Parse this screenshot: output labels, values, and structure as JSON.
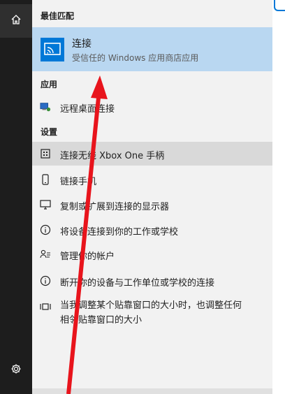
{
  "sections": {
    "best": "最佳匹配",
    "apps": "应用",
    "settings": "设置"
  },
  "best_match": {
    "title": "连接",
    "subtitle": "受信任的 Windows 应用商店应用"
  },
  "apps": [
    {
      "label": "远程桌面连接",
      "icon": "remote-desktop-icon"
    }
  ],
  "settings": [
    {
      "label": "连接无线 Xbox One 手柄",
      "icon": "gamepad-icon",
      "selected": true
    },
    {
      "label": "链接手机",
      "icon": "phone-icon"
    },
    {
      "label": "复制或扩展到连接的显示器",
      "icon": "monitor-icon"
    },
    {
      "label": "将设备连接到你的工作或学校",
      "icon": "info-icon"
    },
    {
      "label": "管理你的帐户",
      "icon": "accounts-icon"
    },
    {
      "label": "断开你的设备与工作单位或学校的连接",
      "icon": "info-icon"
    },
    {
      "label": "当我调整某个贴靠窗口的大小时，也调整任何相邻贴靠窗口的大小",
      "icon": "snap-icon"
    }
  ],
  "colors": {
    "rail": "#1d1d1d",
    "highlight": "#b9d7f1",
    "accent": "#0078d7",
    "annotation_arrow": "#e8141c"
  }
}
